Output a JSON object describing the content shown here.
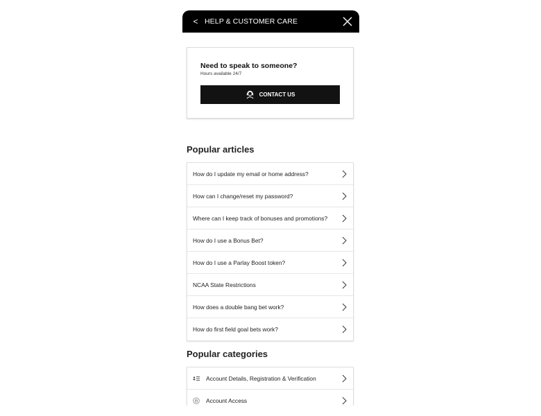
{
  "header": {
    "back_icon": "<",
    "title": "HELP & CUSTOMER CARE",
    "close_icon": "close-icon"
  },
  "contact_card": {
    "title": "Need to speak to someone?",
    "subtitle": "Hours available 24/7",
    "button_label": "CONTACT US",
    "button_icon": "headset-icon"
  },
  "popular_articles": {
    "title": "Popular articles",
    "items": [
      {
        "label": "How do I update my email or home address?"
      },
      {
        "label": "How can I change/reset my password?"
      },
      {
        "label": "Where can I keep track of bonuses and promotions?"
      },
      {
        "label": "How do I use a Bonus Bet?"
      },
      {
        "label": "How do I use a Parlay Boost token?"
      },
      {
        "label": "NCAA State Restrictions"
      },
      {
        "label": "How does a double bang bet work?"
      },
      {
        "label": "How do first field goal bets work?"
      }
    ]
  },
  "popular_categories": {
    "title": "Popular categories",
    "items": [
      {
        "label": "Account Details, Registration & Verification",
        "icon": "id-card-icon"
      },
      {
        "label": "Account Access",
        "icon": "lock-circle-icon"
      }
    ]
  },
  "colors": {
    "header_bg": "#000000",
    "button_bg": "#121212",
    "text": "#222222"
  }
}
